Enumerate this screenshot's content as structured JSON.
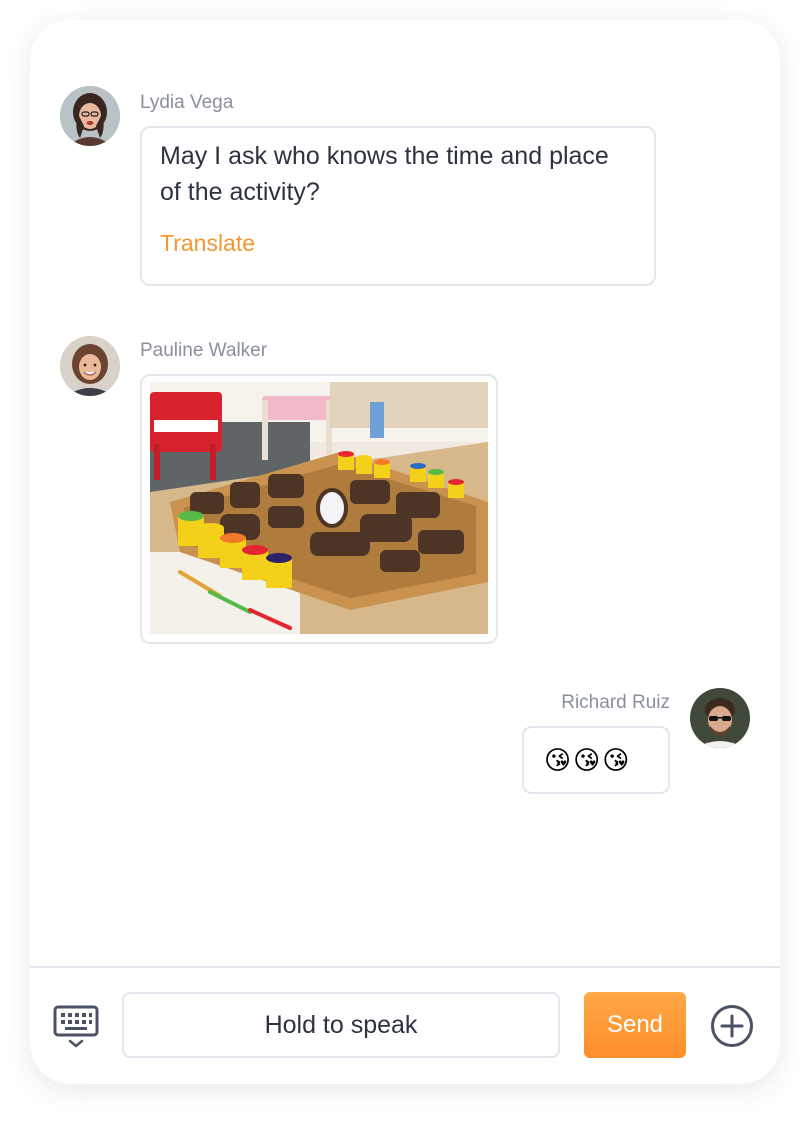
{
  "messages": [
    {
      "sender": "Lydia Vega",
      "text": "May I ask who knows the time and place of the activity?",
      "action": "Translate"
    },
    {
      "sender": "Pauline Walker",
      "attachment": "photo"
    },
    {
      "sender": "Richard Ruiz",
      "text": "😘😘😘"
    }
  ],
  "composer": {
    "hold_label": "Hold to speak",
    "send_label": "Send"
  },
  "icons": {
    "keyboard": "keyboard-icon",
    "add": "plus-circle-icon"
  },
  "colors": {
    "accent": "#f5962e",
    "send_gradient_top": "#ffa946",
    "send_gradient_bottom": "#ff8d2a",
    "border": "#e4e6ee",
    "name_text": "#8a8f9c",
    "body_text": "#2e3340"
  }
}
